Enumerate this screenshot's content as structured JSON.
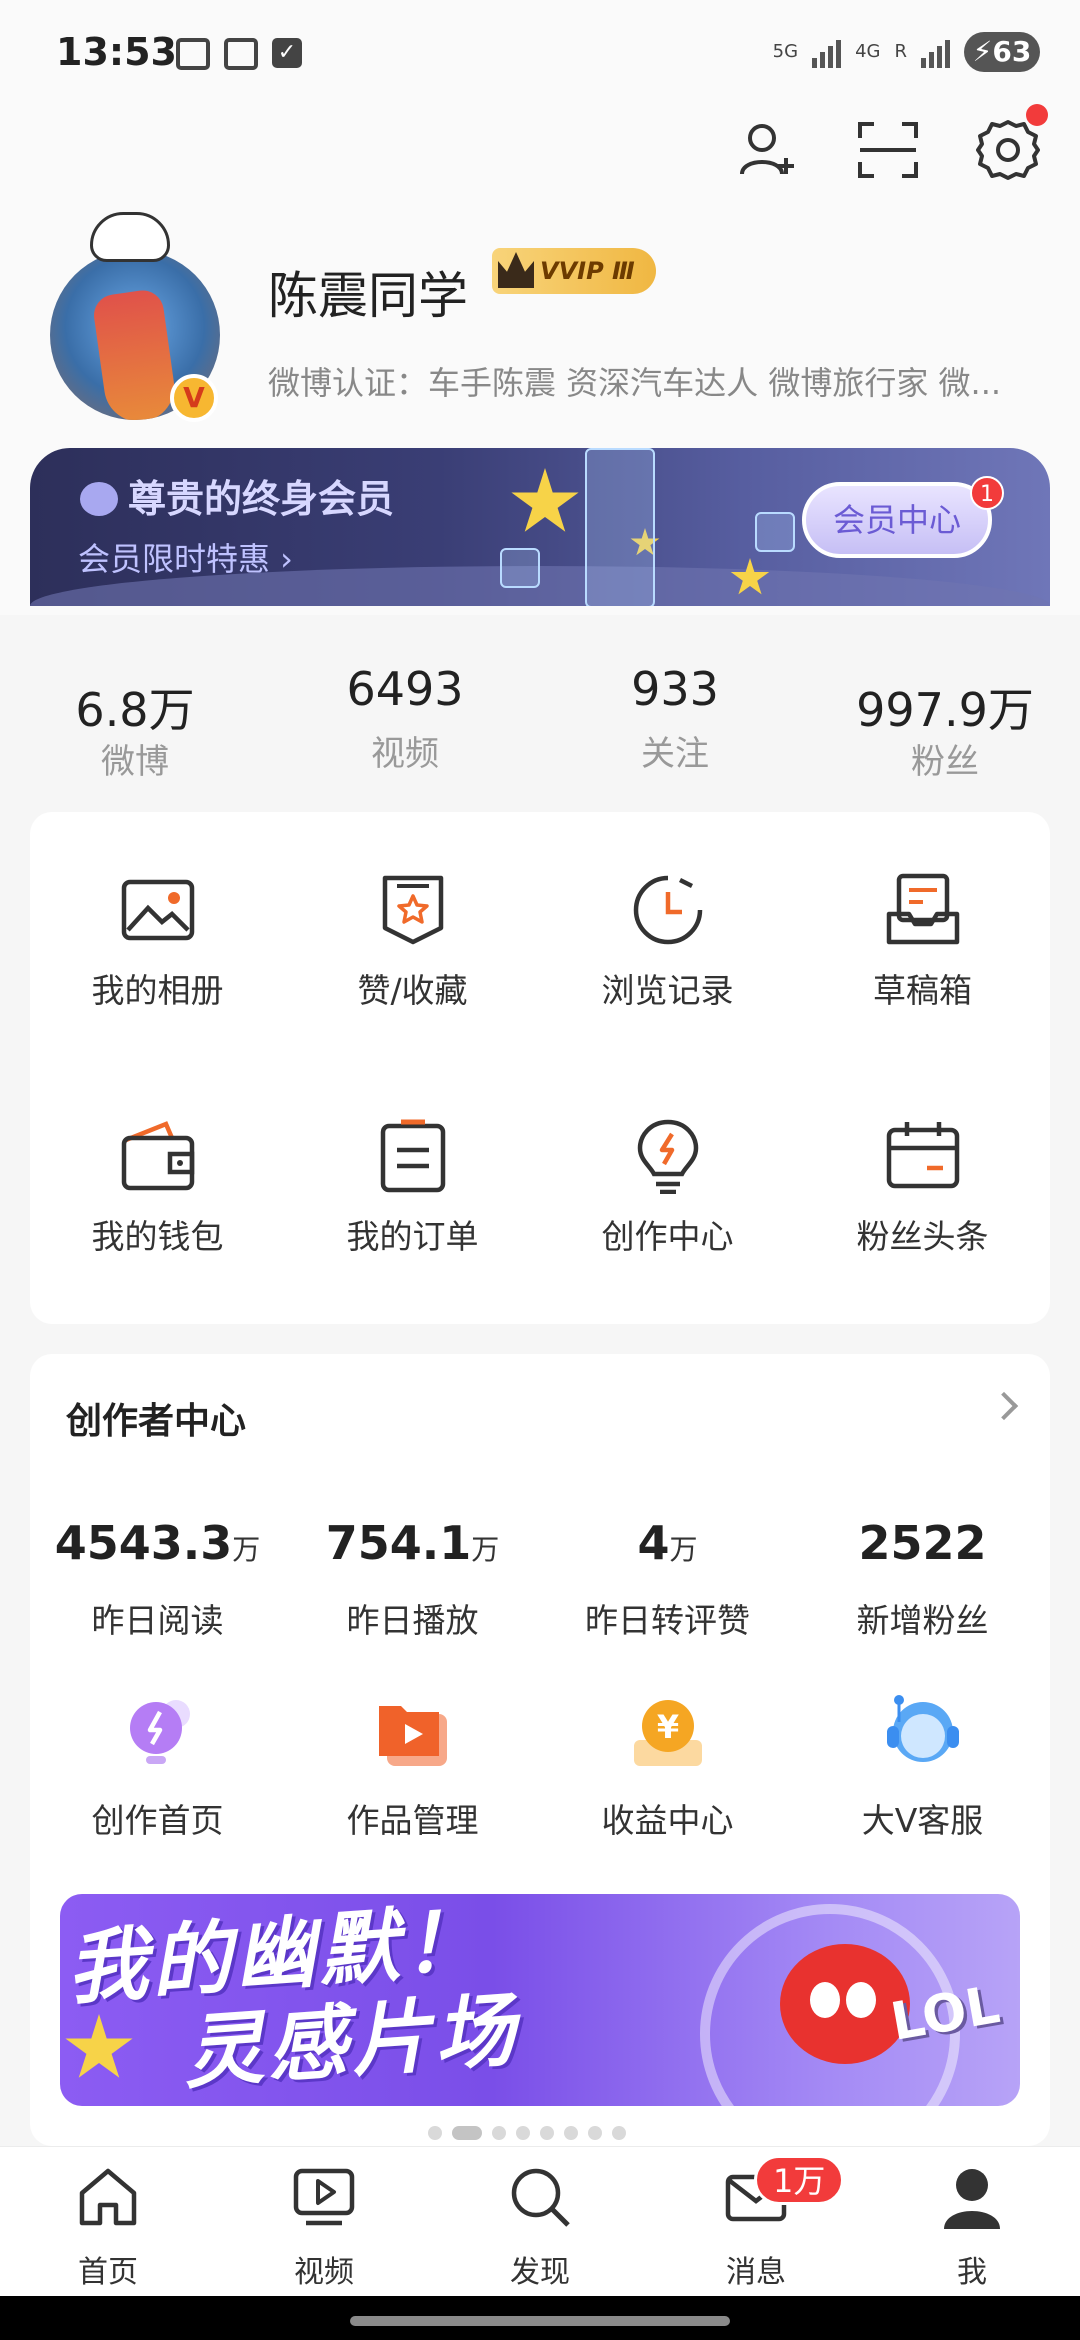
{
  "status": {
    "time": "13:53",
    "net1": "5G",
    "net2": "4G",
    "net2_suffix": "R",
    "battery": "63"
  },
  "profile": {
    "name": "陈震同学",
    "vip_label": "VVIP Ⅲ",
    "verification": "微博认证：车手陈震 资深汽车达人 微博旅行家 微..."
  },
  "member": {
    "title": "尊贵的终身会员",
    "subtitle": "会员限时特惠 ›",
    "button": "会员中心",
    "badge": "1"
  },
  "stats": [
    {
      "value": "6.8万",
      "label": "微博"
    },
    {
      "value": "6493",
      "label": "视频"
    },
    {
      "value": "933",
      "label": "关注"
    },
    {
      "value": "997.9万",
      "label": "粉丝"
    }
  ],
  "functions": [
    {
      "label": "我的相册",
      "icon": "photo-album-icon"
    },
    {
      "label": "赞/收藏",
      "icon": "favorites-icon"
    },
    {
      "label": "浏览记录",
      "icon": "history-icon"
    },
    {
      "label": "草稿箱",
      "icon": "drafts-icon"
    },
    {
      "label": "我的钱包",
      "icon": "wallet-icon"
    },
    {
      "label": "我的订单",
      "icon": "orders-icon"
    },
    {
      "label": "创作中心",
      "icon": "creation-bulb-icon"
    },
    {
      "label": "粉丝头条",
      "icon": "fans-headline-icon"
    }
  ],
  "creator": {
    "title": "创作者中心",
    "stats": [
      {
        "value": "4543.3",
        "unit": "万",
        "label": "昨日阅读"
      },
      {
        "value": "754.1",
        "unit": "万",
        "label": "昨日播放"
      },
      {
        "value": "4",
        "unit": "万",
        "label": "昨日转评赞"
      },
      {
        "value": "2522",
        "unit": "",
        "label": "新增粉丝"
      }
    ],
    "functions": [
      {
        "label": "创作首页",
        "icon": "creation-home-icon",
        "color": "#a35cf0"
      },
      {
        "label": "作品管理",
        "icon": "works-manage-icon",
        "color": "#f06a2a"
      },
      {
        "label": "收益中心",
        "icon": "income-icon",
        "color": "#f5a623"
      },
      {
        "label": "大V客服",
        "icon": "customer-service-icon",
        "color": "#3b8ef0"
      }
    ],
    "banner": {
      "line1": "我的幽默！",
      "line2": "灵感片场",
      "tag": "LOL"
    }
  },
  "tabs": [
    {
      "label": "首页",
      "icon": "home-icon"
    },
    {
      "label": "视频",
      "icon": "video-icon"
    },
    {
      "label": "发现",
      "icon": "discover-search-icon"
    },
    {
      "label": "消息",
      "icon": "message-icon",
      "badge": "1万"
    },
    {
      "label": "我",
      "icon": "me-icon"
    }
  ],
  "colors": {
    "accent": "#f06a2a",
    "badge": "#f23b3b",
    "member_bg": "#2d2f5a"
  }
}
